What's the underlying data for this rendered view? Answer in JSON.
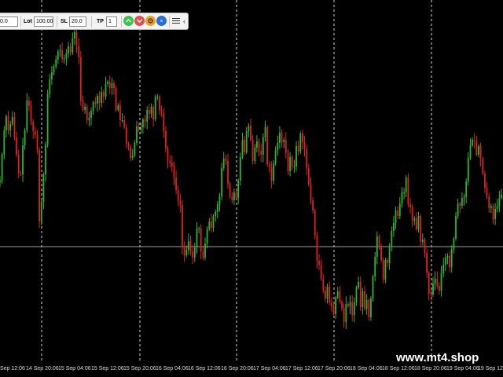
{
  "toolbar": {
    "lot_field_left_value": "0.0",
    "lot_label": "Lot",
    "lot_value": "100.00",
    "sl_label": "SL",
    "sl_value": "20.0",
    "tp_label": "TP",
    "tp_value": "1",
    "buy_icon": "chevron-up-icon",
    "sell_icon": "chevron-down-icon",
    "settings_icon": "gear-icon",
    "info_icon": "circle-icon",
    "menu_icon": "hamburger-menu-icon",
    "collapse_glyph": "‹",
    "colors": {
      "buy": "#3cc44a",
      "sell": "#e05050",
      "settings": "#f0a020",
      "info": "#2a6fd6"
    }
  },
  "x_axis": {
    "labels": [
      "Sep 12:06",
      "14 Sep 20:06",
      "15 Sep 04:06",
      "15 Sep 12:06",
      "15 Sep 20:06",
      "16 Sep 04:06",
      "16 Sep 12:06",
      "16 Sep 20:06",
      "17 Sep 04:06",
      "17 Sep 12:06",
      "17 Sep 20:06",
      "18 Sep 04:06",
      "18 Sep 12:06",
      "18 Sep 20:06",
      "19 Sep 04:06",
      "19 Sep 12:06"
    ]
  },
  "chart": {
    "colors": {
      "bull": "#2ab82a",
      "bear": "#e02020",
      "grid": "#cfcfcf",
      "hline": "#a0a0a0",
      "background": "#000000"
    },
    "candles": [
      250,
      283,
      314,
      332,
      314,
      322,
      331,
      305,
      283,
      259,
      258,
      295,
      314,
      352,
      345,
      325,
      313,
      308,
      289,
      198,
      223,
      258,
      296,
      360,
      379,
      388,
      395,
      404,
      415,
      416,
      405,
      405,
      412,
      421,
      413,
      431,
      439,
      422,
      407,
      352,
      340,
      344,
      327,
      330,
      339,
      350,
      348,
      358,
      349,
      363,
      357,
      373,
      376,
      368,
      374,
      368,
      340,
      346,
      327,
      327,
      318,
      297,
      293,
      279,
      282,
      298,
      319,
      315,
      318,
      328,
      325,
      340,
      335,
      344,
      328,
      357,
      357,
      340,
      336,
      313,
      291,
      275,
      273,
      268,
      254,
      238,
      225,
      219,
      166,
      155,
      162,
      173,
      160,
      152,
      165,
      188,
      189,
      160,
      152,
      170,
      188,
      198,
      190,
      205,
      210,
      220,
      230,
      266,
      278,
      275,
      246,
      230,
      225,
      235,
      228,
      250,
      280,
      302,
      286,
      313,
      320,
      302,
      275,
      292,
      300,
      288,
      283,
      305,
      318,
      271,
      268,
      250,
      272,
      289,
      298,
      311,
      299,
      302,
      285,
      262,
      280,
      268,
      268,
      294,
      287,
      310,
      299,
      290,
      266,
      245,
      225,
      212,
      180,
      148,
      143,
      125,
      110,
      100,
      115,
      95,
      90,
      80,
      101,
      109,
      96,
      88,
      70,
      93,
      90,
      95,
      79,
      95,
      114,
      121,
      89,
      109,
      87,
      98,
      76,
      100,
      128,
      153,
      179,
      167,
      149,
      124,
      149,
      145,
      166,
      186,
      196,
      212,
      205,
      221,
      235,
      235,
      254,
      220,
      216,
      199,
      202,
      188,
      205,
      172,
      175,
      158,
      133,
      106,
      105,
      119,
      125,
      116,
      110,
      132,
      143,
      152,
      154,
      140,
      163,
      176,
      205,
      221,
      218,
      228,
      229,
      249,
      279,
      295,
      302,
      300,
      283,
      294,
      278,
      259,
      241,
      230,
      215,
      218,
      201,
      214,
      217,
      228,
      232
    ]
  },
  "watermark": "www.mt4.shop"
}
